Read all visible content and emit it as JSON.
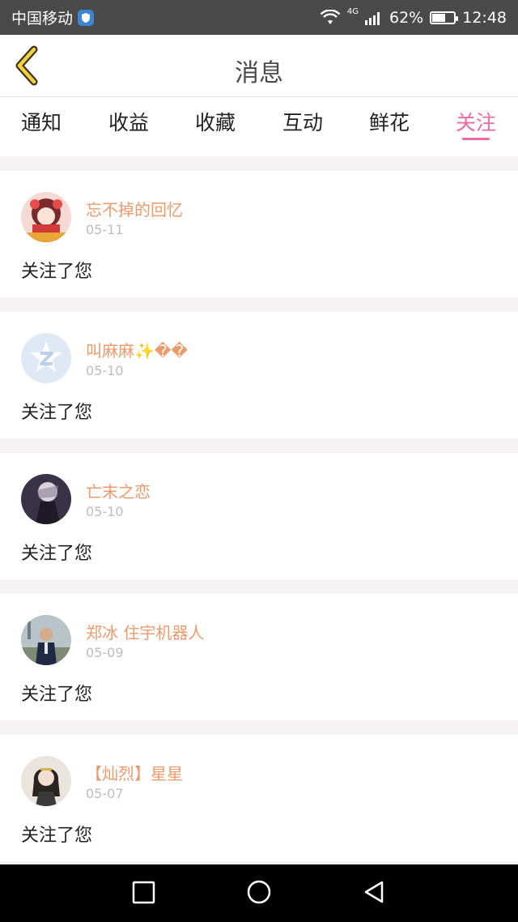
{
  "status": {
    "carrier": "中国移动",
    "network": "4G",
    "battery": "62%",
    "battery_level": 0.62,
    "time": "12:48"
  },
  "header": {
    "title": "消息"
  },
  "tabs": [
    {
      "label": "通知"
    },
    {
      "label": "收益"
    },
    {
      "label": "收藏"
    },
    {
      "label": "互动"
    },
    {
      "label": "鲜花"
    },
    {
      "label": "关注",
      "active": true
    }
  ],
  "items": [
    {
      "name": "忘不掉的回忆",
      "date": "05-11",
      "message": "关注了您",
      "avatar": "anime-girl-avatar"
    },
    {
      "name": "叫麻麻✨��",
      "date": "05-10",
      "message": "关注了您",
      "avatar": "qzone-default-avatar"
    },
    {
      "name": "亡末之恋",
      "date": "05-10",
      "message": "关注了您",
      "avatar": "dark-anime-avatar"
    },
    {
      "name": "郑冰 住宇机器人",
      "date": "05-09",
      "message": "关注了您",
      "avatar": "photo-man-avatar"
    },
    {
      "name": "【灿烈】星星",
      "date": "05-07",
      "message": "关注了您",
      "avatar": "doll-girl-avatar"
    }
  ],
  "colors": {
    "accent": "#e86aa0",
    "name": "#ec9a6a",
    "date": "#bdbdbd"
  }
}
